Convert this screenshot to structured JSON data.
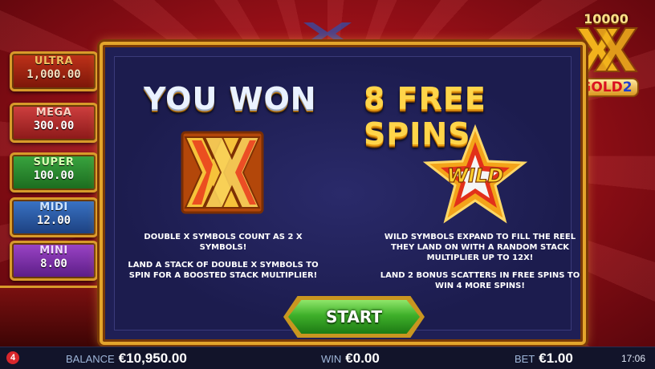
{
  "jackpots": [
    {
      "name": "ULTRA",
      "value": "1,000.00"
    },
    {
      "name": "MEGA",
      "value": "300.00"
    },
    {
      "name": "SUPER",
      "value": "100.00"
    },
    {
      "name": "MIDI",
      "value": "12.00"
    },
    {
      "name": "MINI",
      "value": "8.00"
    }
  ],
  "logo": {
    "multiplier": "10000",
    "brand": "GOLD",
    "sequel": "2"
  },
  "popup": {
    "title_left": "YOU WON",
    "title_right": "8 FREE SPINS",
    "wild_label": "WILD",
    "left_text": [
      "DOUBLE X SYMBOLS COUNT AS 2 X SYMBOLS!",
      "LAND A STACK OF DOUBLE X SYMBOLS TO SPIN FOR A BOOSTED STACK MULTIPLIER!"
    ],
    "right_text": [
      "WILD SYMBOLS EXPAND TO FILL THE REEL THEY LAND ON WITH A RANDOM STACK MULTIPLIER UP TO 12X!",
      "LAND 2 BONUS SCATTERS IN FREE SPINS TO WIN 4 MORE SPINS!"
    ],
    "start_label": "START"
  },
  "status_bar": {
    "menu_badge": "4",
    "balance_label": "BALANCE",
    "balance_value": "€10,950.00",
    "win_label": "WIN",
    "win_value": "€0.00",
    "bet_label": "BET",
    "bet_value": "€1.00",
    "clock": "17:06"
  },
  "colors": {
    "frame_gold": "#e3a52c",
    "panel_navy": "#1f1f55",
    "start_green": "#3fb02a",
    "background_red": "#9a1018"
  }
}
